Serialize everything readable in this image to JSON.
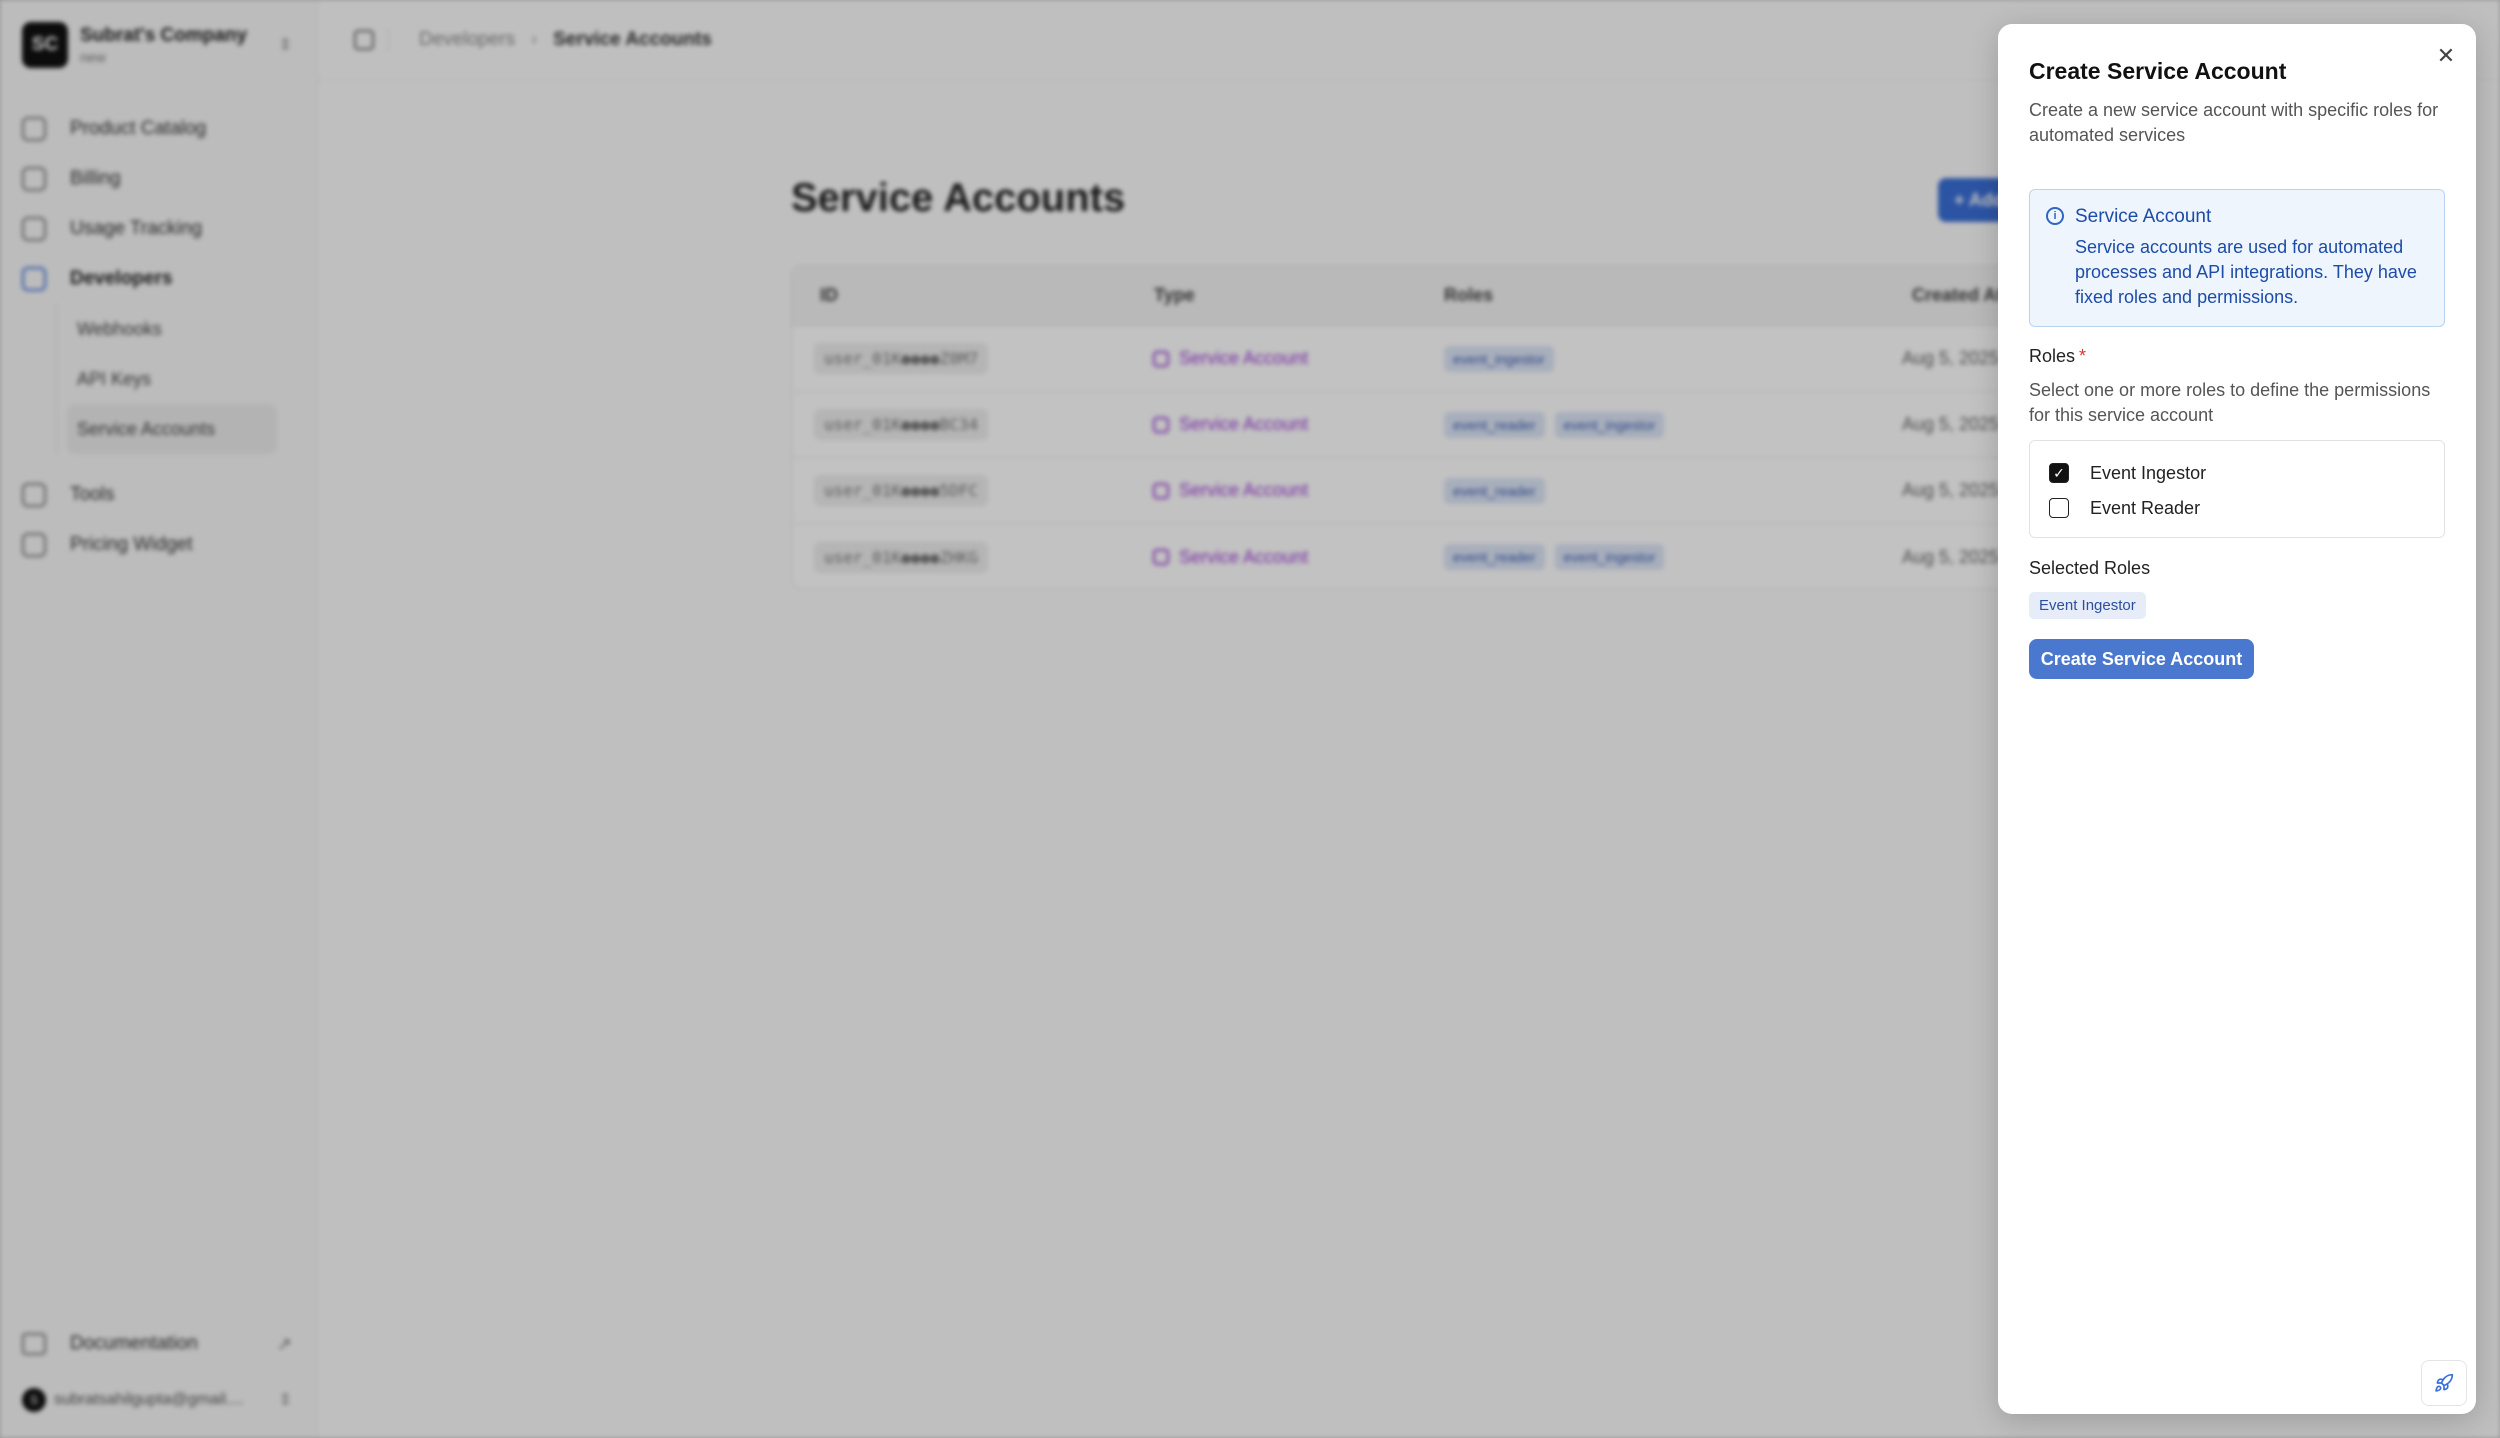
{
  "sidebar": {
    "org": {
      "logo": "SC",
      "name": "Subrat's Company",
      "sub": "new"
    },
    "items": [
      {
        "label": "Product Catalog",
        "icon": "cube-icon"
      },
      {
        "label": "Billing",
        "icon": "billing-icon"
      },
      {
        "label": "Usage Tracking",
        "icon": "gauge-icon"
      },
      {
        "label": "Developers",
        "icon": "code-icon"
      }
    ],
    "developer_sub": [
      "Webhooks",
      "API Keys",
      "Service Accounts"
    ],
    "items_after": [
      {
        "label": "Tools",
        "icon": "gear-icon"
      },
      {
        "label": "Pricing Widget",
        "icon": "grid-icon"
      }
    ],
    "documentation": "Documentation",
    "user_initial": "S",
    "user_email": "subratsahilgupta@gmail...."
  },
  "breadcrumb": {
    "parent": "Developers",
    "current": "Service Accounts"
  },
  "page": {
    "title": "Service Accounts",
    "add_button": "+ Add"
  },
  "table": {
    "headers": [
      "ID",
      "Type",
      "Roles",
      "Created At"
    ],
    "rows": [
      {
        "id": "user_01K●●●●Z0M7",
        "type": "Service Account",
        "roles": [
          "event_ingestor"
        ],
        "created": "Aug 5, 2025"
      },
      {
        "id": "user_01K●●●●BC34",
        "type": "Service Account",
        "roles": [
          "event_reader",
          "event_ingestor"
        ],
        "created": "Aug 5, 2025"
      },
      {
        "id": "user_01K●●●●5DFC",
        "type": "Service Account",
        "roles": [
          "event_reader"
        ],
        "created": "Aug 5, 2025"
      },
      {
        "id": "user_01K●●●●ZHKG",
        "type": "Service Account",
        "roles": [
          "event_reader",
          "event_ingestor"
        ],
        "created": "Aug 5, 2025"
      }
    ]
  },
  "sheet": {
    "title": "Create Service Account",
    "description": "Create a new service account with specific roles for automated services",
    "info_title": "Service Account",
    "info_text": "Service accounts are used for automated processes and API integrations. They have fixed roles and permissions.",
    "roles_label": "Roles",
    "required_mark": "*",
    "roles_help": "Select one or more roles to define the permissions for this service account",
    "role_options": [
      {
        "label": "Event Ingestor",
        "checked": true
      },
      {
        "label": "Event Reader",
        "checked": false
      }
    ],
    "selected_label": "Selected Roles",
    "selected_roles": [
      "Event Ingestor"
    ],
    "submit_label": "Create Service Account",
    "close_glyph": "✕"
  },
  "colors": {
    "accent": "#4a78cf",
    "info_bg": "#eef5fd",
    "info_text": "#1d4ca8",
    "type_purple": "#9b3ad6"
  }
}
